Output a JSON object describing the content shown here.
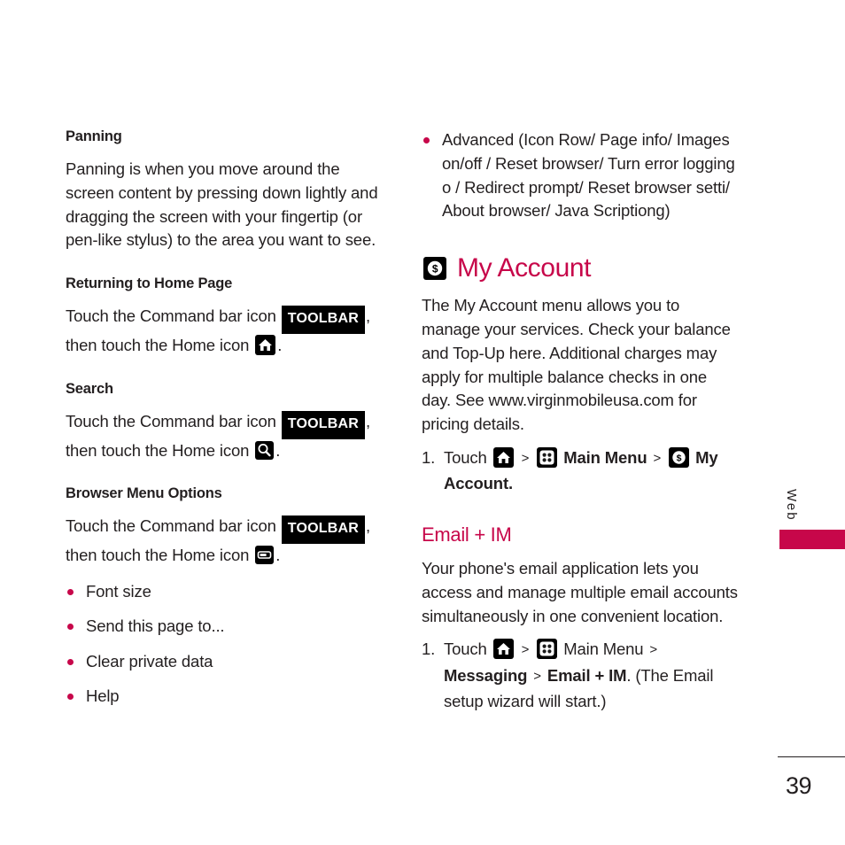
{
  "page": {
    "number": "39",
    "tab_label": "Web",
    "accent_color": "#c7074a",
    "text_color": "#231f20"
  },
  "left_column": {
    "sections": [
      {
        "heading": "Panning",
        "body": "Panning is when you move around the screen content by pressing down lightly and dragging the screen with your fingertip (or pen-like stylus) to the area you want to see."
      },
      {
        "heading": "Returning to Home Page",
        "lead": "Touch the Command bar icon",
        "chip": "TOOLBAR",
        "mid": ", then touch the Home icon",
        "icon": "home-icon",
        "tail": "."
      },
      {
        "heading": "Search",
        "lead": "Touch the Command bar icon",
        "chip": "TOOLBAR",
        "mid": ", then touch the Home icon",
        "icon": "search-icon",
        "tail": "."
      },
      {
        "heading": "Browser Menu Options",
        "lead": "Touch the Command bar icon",
        "chip": "TOOLBAR",
        "mid": ", then touch the Home icon",
        "icon": "browser-menu-icon",
        "tail": "."
      }
    ],
    "browser_menu_bullets": [
      "Font size",
      "Send this page to...",
      "Clear private data",
      "Help"
    ]
  },
  "right_column": {
    "advanced_bullet": "Advanced (Icon Row/ Page info/ Images on/off / Reset browser/ Turn error logging o / Redirect prompt/ Reset browser setti/ About browser/ Java Scriptiong)",
    "my_account": {
      "heading": "My Account",
      "heading_icon": "dollar-coin-icon",
      "body": "The My Account menu allows you to manage your services. Check your balance and Top-Up here. Additional charges may apply for multiple balance checks in one day. See www.virginmobileusa.com for pricing details.",
      "step": {
        "number": "1.",
        "t1": "Touch",
        "icon1": "home-icon",
        "sep1": ">",
        "icon2": "main-menu-icon",
        "t2": "Main Menu",
        "sep2": ">",
        "icon3": "dollar-coin-icon",
        "t3": "My Account."
      }
    },
    "email_im": {
      "heading": "Email + IM",
      "body": "Your phone's email application lets you access and manage multiple email accounts simultaneously in one convenient location.",
      "step": {
        "number": "1.",
        "t1": "Touch",
        "icon1": "home-icon",
        "sep1": ">",
        "icon2": "main-menu-icon",
        "t2": "Main Menu",
        "sep2": ">",
        "t3": "Messaging",
        "sep3": ">",
        "t4": "Email + IM",
        "t5": ". (The Email setup wizard will start.)"
      }
    }
  }
}
